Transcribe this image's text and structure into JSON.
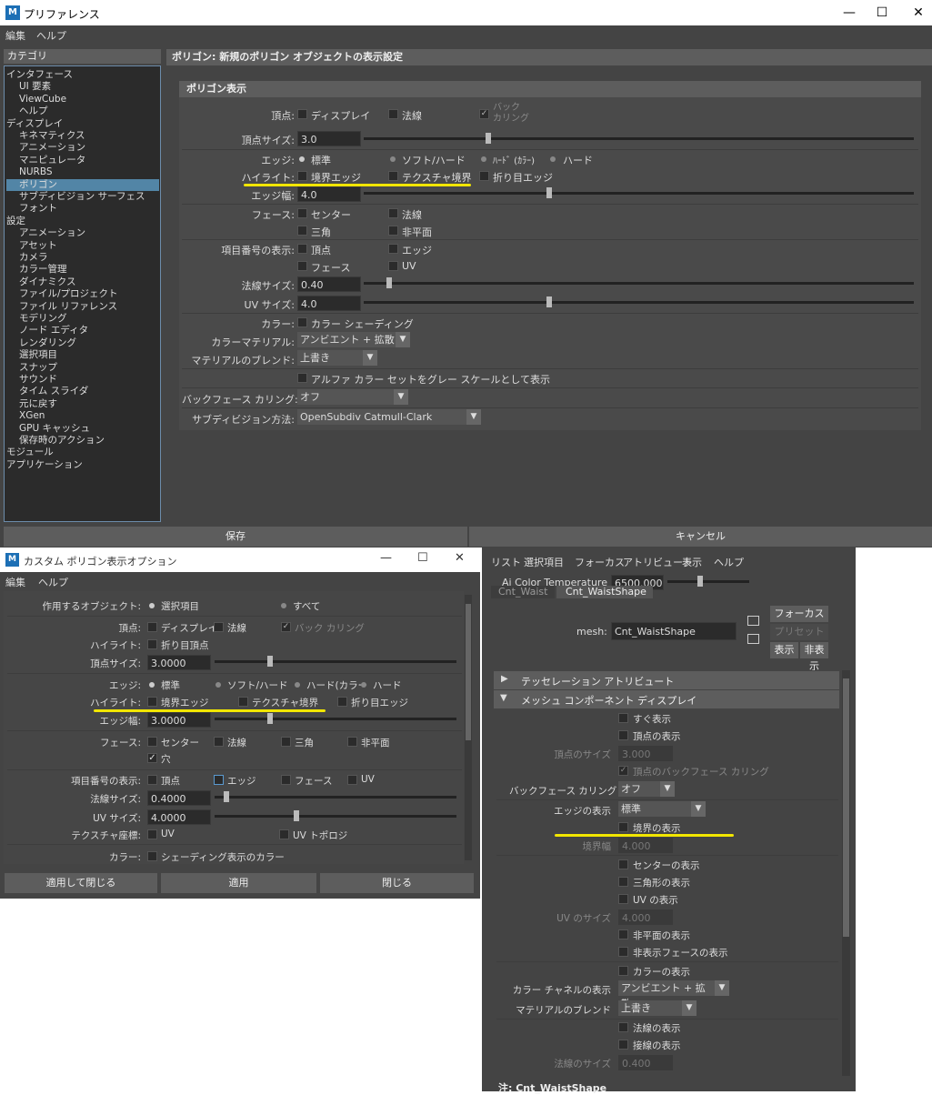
{
  "pref": {
    "title": "プリファレンス",
    "menu": [
      "編集",
      "ヘルプ"
    ],
    "category_label": "カテゴリ",
    "categories": [
      "インタフェース",
      "UI 要素",
      "ViewCube",
      "ヘルプ",
      "ディスプレイ",
      "キネマティクス",
      "アニメーション",
      "マニピュレータ",
      "NURBS",
      "ポリゴン",
      "サブディビジョン サーフェス",
      "フォント",
      "設定",
      "アニメーション",
      "アセット",
      "カメラ",
      "カラー管理",
      "ダイナミクス",
      "ファイル/プロジェクト",
      "ファイル リファレンス",
      "モデリング",
      "ノード エディタ",
      "レンダリング",
      "選択項目",
      "スナップ",
      "サウンド",
      "タイム スライダ",
      "元に戻す",
      "XGen",
      "GPU キャッシュ",
      "保存時のアクション",
      "モジュール",
      "アプリケーション"
    ],
    "panel_title": "ポリゴン: 新規のポリゴン オブジェクトの表示設定",
    "section": "ポリゴン表示",
    "vertex_label": "頂点:",
    "vertex_opts": [
      "ディスプレイ",
      "法線",
      "バック\nカリング"
    ],
    "vertex_size_label": "頂点サイズ:",
    "vertex_size": "3.0",
    "edge_label": "エッジ:",
    "edge_opts": [
      "標準",
      "ソフト/ハード",
      "ﾊｰﾄﾞ (ｶﾗｰ)",
      "ハード"
    ],
    "highlight_label": "ハイライト:",
    "highlight_opts": [
      "境界エッジ",
      "テクスチャ境界",
      "折り目エッジ"
    ],
    "edge_width_label": "エッジ幅:",
    "edge_width": "4.0",
    "face_label": "フェース:",
    "face_opts": [
      "センター",
      "法線",
      "三角",
      "非平面"
    ],
    "item_num_label": "項目番号の表示:",
    "item_num_opts": [
      "頂点",
      "エッジ",
      "フェース",
      "UV"
    ],
    "normal_size_label": "法線サイズ:",
    "normal_size": "0.40",
    "uv_size_label": "UV サイズ:",
    "uv_size": "4.0",
    "color_label": "カラー:",
    "color_opt": "カラー シェーディング",
    "color_material_label": "カラーマテリアル:",
    "color_material": "アンビエント + 拡散",
    "material_blend_label": "マテリアルのブレンド:",
    "material_blend": "上書き",
    "alpha_opt": "アルファ カラー セットをグレー スケールとして表示",
    "backface_label": "バックフェース カリング:",
    "backface": "オフ",
    "subdiv_label": "サブディビジョン方法:",
    "subdiv": "OpenSubdiv Catmull-Clark",
    "save": "保存",
    "cancel": "キャンセル"
  },
  "custom": {
    "title": "カスタム ポリゴン表示オプション",
    "menu": [
      "編集",
      "ヘルプ"
    ],
    "target_label": "作用するオブジェクト:",
    "target_opts": [
      "選択項目",
      "すべて"
    ],
    "vertex_label": "頂点:",
    "vertex_opts": [
      "ディスプレイ",
      "法線",
      "バック カリング"
    ],
    "highlight_label": "ハイライト:",
    "highlight_opt": "折り目頂点",
    "vertex_size_label": "頂点サイズ:",
    "vertex_size": "3.0000",
    "edge_label": "エッジ:",
    "edge_opts": [
      "標準",
      "ソフト/ハード",
      "ハード(カラー",
      "ハード"
    ],
    "highlight2_label": "ハイライト:",
    "highlight2_opts": [
      "境界エッジ",
      "テクスチャ境界",
      "折り目エッジ"
    ],
    "edge_width_label": "エッジ幅:",
    "edge_width": "3.0000",
    "face_label": "フェース:",
    "face_opts": [
      "センター",
      "法線",
      "三角",
      "非平面",
      "穴"
    ],
    "item_num_label": "項目番号の表示:",
    "item_num_opts": [
      "頂点",
      "エッジ",
      "フェース",
      "UV"
    ],
    "normal_size_label": "法線サイズ:",
    "normal_size": "0.4000",
    "uv_size_label": "UV サイズ:",
    "uv_size": "4.0000",
    "tex_label": "テクスチャ座標:",
    "tex_opts": [
      "UV",
      "UV トポロジ"
    ],
    "color_label": "カラー:",
    "color_opt": "シェーディング表示のカラー",
    "btn_apply_close": "適用して閉じる",
    "btn_apply": "適用",
    "btn_close": "閉じる"
  },
  "attr": {
    "menu": [
      "リスト",
      "選択項目",
      "フォーカス",
      "アトリビュート",
      "表示",
      "ヘルプ"
    ],
    "ai_color_label": "Ai Color Temperature",
    "ai_color_value": "6500.000",
    "tabs": [
      "Cnt_Waist",
      "Cnt_WaistShape"
    ],
    "mesh_label": "mesh:",
    "mesh_value": "Cnt_WaistShape",
    "btn_focus": "フォーカス",
    "btn_preset": "プリセット",
    "btn_show": "表示",
    "btn_hide": "非表示",
    "sec_tess": "テッセレーション アトリビュート",
    "sec_mesh": "メッシュ コンポーネント ディスプレイ",
    "opt_immediate": "すぐ表示",
    "opt_vertex_show": "頂点の表示",
    "vertex_size_label": "頂点のサイズ",
    "vertex_size": "3.000",
    "opt_vertex_backface": "頂点のバックフェース カリング",
    "backface_label": "バックフェース カリング",
    "backface": "オフ",
    "edge_show_label": "エッジの表示",
    "edge_show": "標準",
    "opt_border": "境界の表示",
    "border_width_label": "境界幅",
    "border_width": "4.000",
    "opt_center": "センターの表示",
    "opt_triangle": "三角形の表示",
    "opt_uv": "UV の表示",
    "uv_size_label": "UV のサイズ",
    "uv_size": "4.000",
    "opt_nonplanar": "非平面の表示",
    "opt_hidden_face": "非表示フェースの表示",
    "opt_color": "カラーの表示",
    "color_channel_label": "カラー チャネルの表示",
    "color_channel": "アンビエント + 拡散",
    "material_blend_label": "マテリアルのブレンド",
    "material_blend": "上書き",
    "opt_normal": "法線の表示",
    "opt_tangent": "接線の表示",
    "normal_size_label": "法線のサイズ",
    "normal_size": "0.400",
    "note": "注: Cnt_WaistShape"
  }
}
